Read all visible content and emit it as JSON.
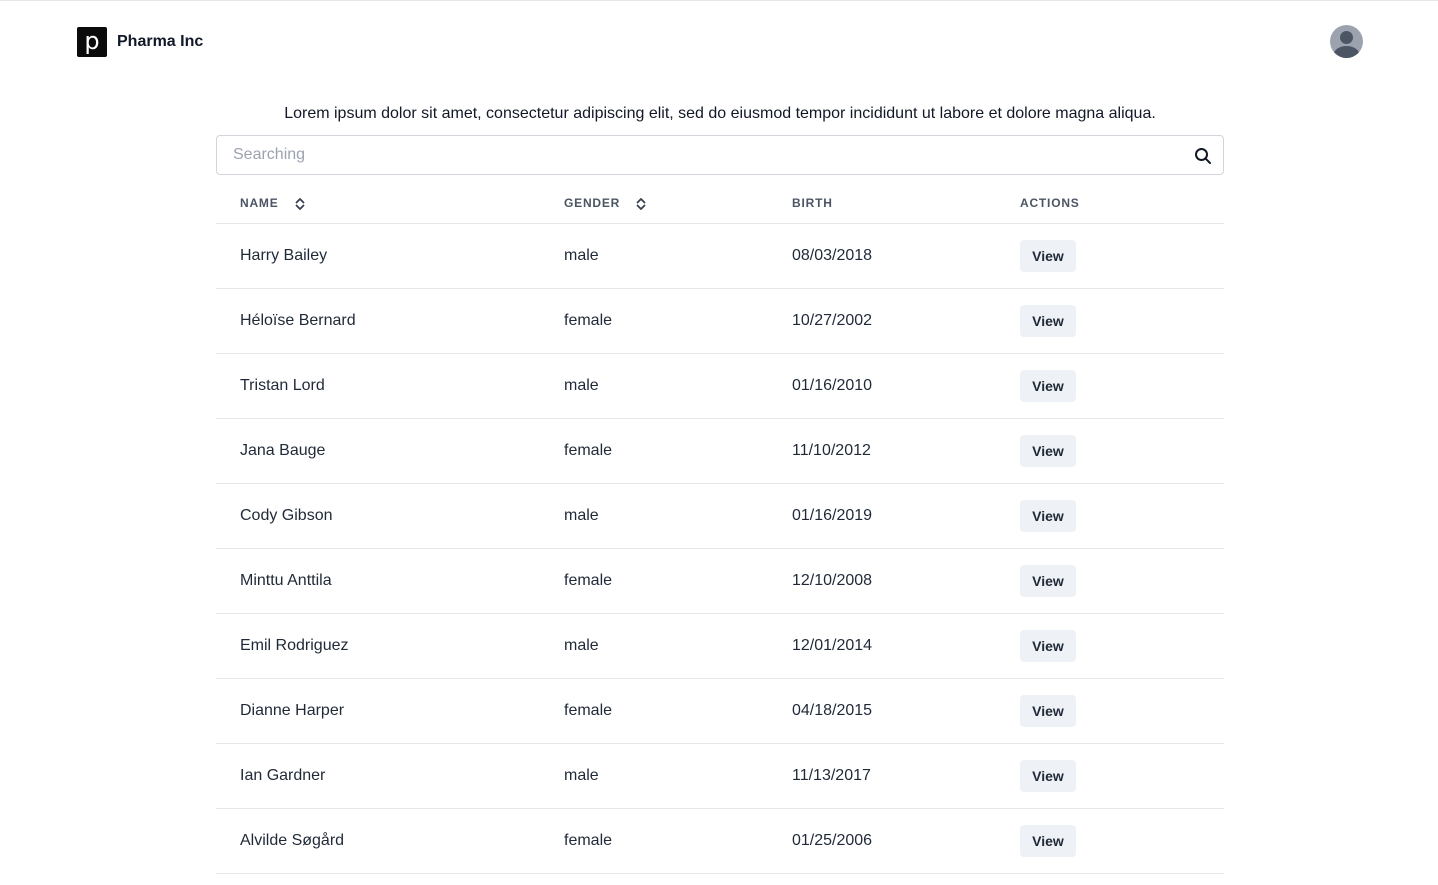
{
  "header": {
    "logo_letter": "p",
    "brand": "Pharma Inc"
  },
  "intro": "Lorem ipsum dolor sit amet, consectetur adipiscing elit, sed do eiusmod tempor incididunt ut labore et dolore magna aliqua.",
  "search": {
    "placeholder": "Searching",
    "value": ""
  },
  "table": {
    "columns": {
      "name": "NAME",
      "gender": "GENDER",
      "birth": "BIRTH",
      "actions": "ACTIONS"
    },
    "rows": [
      {
        "name": "Harry Bailey",
        "gender": "male",
        "birth": "08/03/2018",
        "action": "View"
      },
      {
        "name": "Héloïse Bernard",
        "gender": "female",
        "birth": "10/27/2002",
        "action": "View"
      },
      {
        "name": "Tristan Lord",
        "gender": "male",
        "birth": "01/16/2010",
        "action": "View"
      },
      {
        "name": "Jana Bauge",
        "gender": "female",
        "birth": "11/10/2012",
        "action": "View"
      },
      {
        "name": "Cody Gibson",
        "gender": "male",
        "birth": "01/16/2019",
        "action": "View"
      },
      {
        "name": "Minttu Anttila",
        "gender": "female",
        "birth": "12/10/2008",
        "action": "View"
      },
      {
        "name": "Emil Rodriguez",
        "gender": "male",
        "birth": "12/01/2014",
        "action": "View"
      },
      {
        "name": "Dianne Harper",
        "gender": "female",
        "birth": "04/18/2015",
        "action": "View"
      },
      {
        "name": "Ian Gardner",
        "gender": "male",
        "birth": "11/13/2017",
        "action": "View"
      },
      {
        "name": "Alvilde Søgård",
        "gender": "female",
        "birth": "01/25/2006",
        "action": "View"
      }
    ]
  }
}
